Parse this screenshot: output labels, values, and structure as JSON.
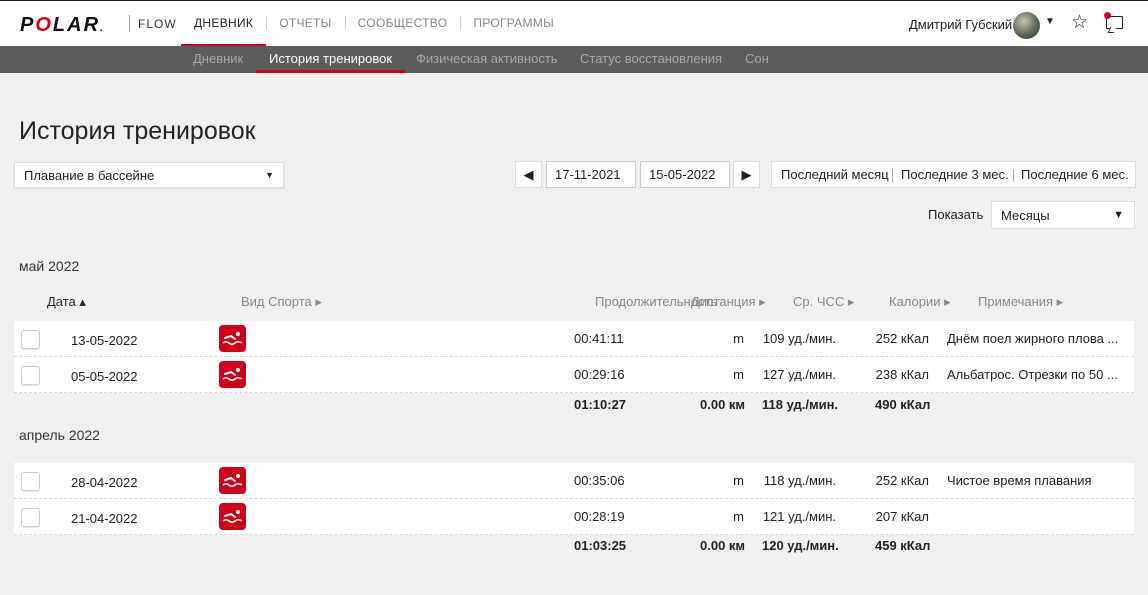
{
  "brand": {
    "logo_part1": "P",
    "logo_o": "O",
    "logo_part2": "LAR",
    "logo_mark": ".",
    "product": "FLOW"
  },
  "colors": {
    "accent": "#d0021b",
    "subnav_bg": "#5c5c5c",
    "page_bg": "#f0f0f0"
  },
  "main_nav": [
    "ДНЕВНИК",
    "ОТЧЕТЫ",
    "СООБЩЕСТВО",
    "ПРОГРАММЫ"
  ],
  "user": {
    "name": "Дмитрий Губский",
    "icons": [
      "star-icon",
      "notifications-icon"
    ]
  },
  "sub_nav": [
    "Дневник",
    "История тренировок",
    "Физическая активность",
    "Статус восстановления",
    "Сон"
  ],
  "page": {
    "title": "История тренировок",
    "sport_filter": "Плавание в бассейне",
    "date_from": "17-11-2021",
    "date_to": "15-05-2022",
    "prev_icon": "◀",
    "next_icon": "▶",
    "ranges": [
      "Последний месяц",
      "Последние 3 мес.",
      "Последние 6 мес."
    ],
    "show_label": "Показать",
    "period": "Месяцы"
  },
  "columns": {
    "date": "Дата ▴",
    "sport": "Вид Спорта ▸",
    "duration": "Продолжительность",
    "distance": "Дистанция ▸",
    "hr": "Ср. ЧСС ▸",
    "calories": "Калории ▸",
    "notes": "Примечания ▸"
  },
  "groups": [
    {
      "month": "май 2022",
      "rows": [
        {
          "date": "13-05-2022",
          "duration": "00:41:11",
          "distance": "m",
          "hr": "109 уд./мин.",
          "calories": "252 кКал",
          "note": "Днём поел жирного плова ..."
        },
        {
          "date": "05-05-2022",
          "duration": "00:29:16",
          "distance": "m",
          "hr": "127 уд./мин.",
          "calories": "238 кКал",
          "note": "Альбатрос. Отрезки по 50 ..."
        }
      ],
      "totals": {
        "duration": "01:10:27",
        "distance": "0.00 км",
        "hr": "118 уд./мин.",
        "calories": "490 кКал"
      }
    },
    {
      "month": "апрель 2022",
      "rows": [
        {
          "date": "28-04-2022",
          "duration": "00:35:06",
          "distance": "m",
          "hr": "118 уд./мин.",
          "calories": "252 кКал",
          "note": "Чистое время плавания"
        },
        {
          "date": "21-04-2022",
          "duration": "00:28:19",
          "distance": "m",
          "hr": "121 уд./мин.",
          "calories": "207 кКал",
          "note": ""
        }
      ],
      "totals": {
        "duration": "01:03:25",
        "distance": "0.00 км",
        "hr": "120 уд./мин.",
        "calories": "459 кКал"
      }
    }
  ]
}
